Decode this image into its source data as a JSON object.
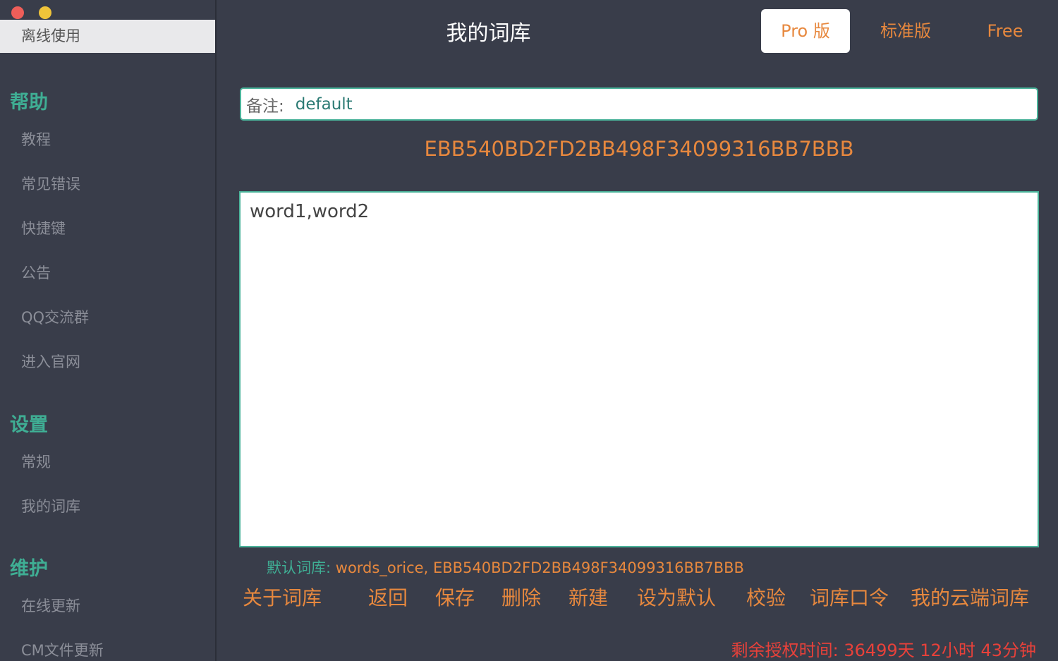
{
  "sidebar": {
    "active_item": "离线使用",
    "sections": [
      {
        "title": "帮助",
        "items": [
          "教程",
          "常见错误",
          "快捷键",
          "公告",
          "QQ交流群",
          "进入官网"
        ]
      },
      {
        "title": "设置",
        "items": [
          "常规",
          "我的词库"
        ]
      },
      {
        "title": "维护",
        "items": [
          "在线更新",
          "CM文件更新"
        ]
      }
    ]
  },
  "header": {
    "title": "我的词库",
    "versions": [
      "Pro 版",
      "标准版",
      "Free"
    ]
  },
  "note": {
    "label": "备注:",
    "value": "default"
  },
  "library_id": "EBB540BD2FD2BB498F34099316BB7BBB",
  "words": "word1,word2",
  "default_library": {
    "label": "默认词库: ",
    "value": "words_orice, EBB540BD2FD2BB498F34099316BB7BBB"
  },
  "actions": [
    "关于词库",
    "返回",
    "保存",
    "删除",
    "新建",
    "设为默认",
    "校验",
    "词库口令",
    "我的云端词库"
  ],
  "license": "剩余授权时间: 36499天 12小时 43分钟",
  "colors": {
    "accent_orange": "#e7883e",
    "accent_green": "#3fae94",
    "warning_red": "#e8413a",
    "background": "#393d4a"
  }
}
